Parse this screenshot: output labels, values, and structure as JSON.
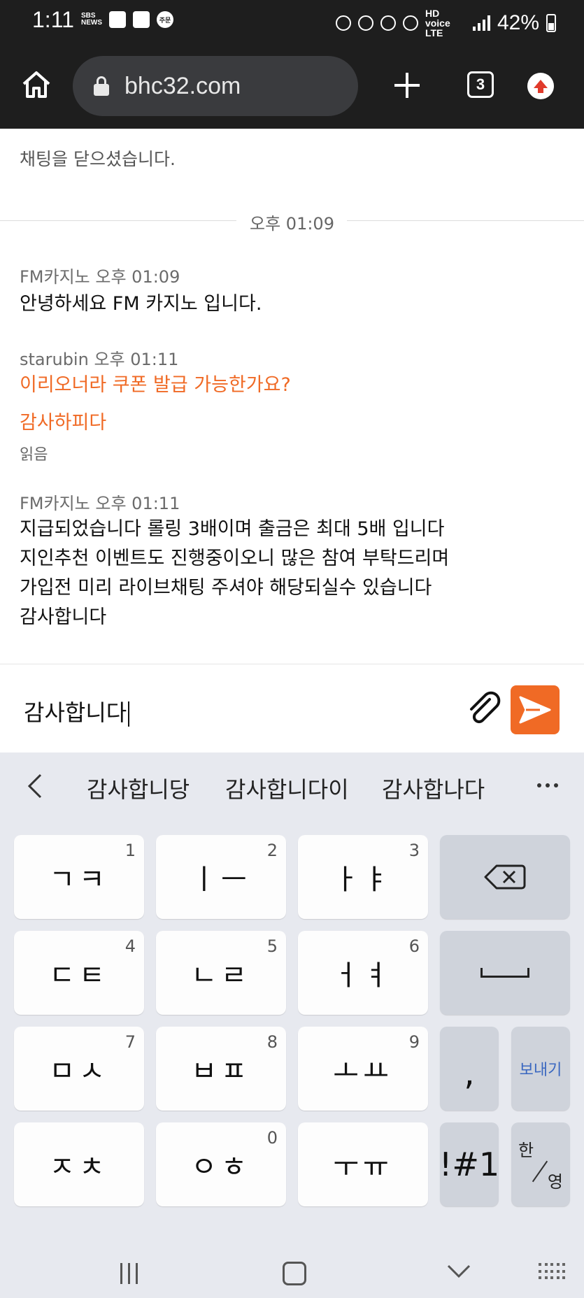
{
  "status_bar": {
    "time": "1:11",
    "left_icons": [
      "SBS NEWS",
      "calendar",
      "gallery",
      "주문"
    ],
    "network": "HD voice LTE",
    "battery": "42%"
  },
  "browser": {
    "url": "bhc32.com",
    "tab_count": "3"
  },
  "chat": {
    "closed_note": "채팅을 닫으셨습니다.",
    "time_divider": "오후 01:09",
    "messages": [
      {
        "meta": "FM카지노 오후 01:09",
        "lines": [
          "안녕하세요 FM 카지노 입니다."
        ]
      },
      {
        "meta": "starubin 오후 01:11",
        "lines": [
          "이리오너라 쿠폰 발급 가능한가요?",
          "감사하피다"
        ],
        "read": "읽음"
      },
      {
        "meta": "FM카지노 오후 01:11",
        "lines": [
          "지급되었습니다 롤링 3배이며 출금은 최대 5배 입니다",
          "지인추천 이벤트도 진행중이오니 많은 참여 부탁드리며",
          "가입전 미리 라이브채팅 주셔야 해당되실수 있습니다",
          "감사합니다"
        ]
      }
    ]
  },
  "input": {
    "value": "감사합니다"
  },
  "keyboard": {
    "suggestions": [
      "감사합니당",
      "감사합니다이",
      "감사합나다"
    ],
    "rows": [
      [
        {
          "main": "ㄱㅋ",
          "hint": "1"
        },
        {
          "main": "ㅣㅡ",
          "hint": "2"
        },
        {
          "main": "ㅏㅑ",
          "hint": "3"
        }
      ],
      [
        {
          "main": "ㄷㅌ",
          "hint": "4"
        },
        {
          "main": "ㄴㄹ",
          "hint": "5"
        },
        {
          "main": "ㅓㅕ",
          "hint": "6"
        }
      ],
      [
        {
          "main": "ㅁㅅ",
          "hint": "7"
        },
        {
          "main": "ㅂㅍ",
          "hint": "8"
        },
        {
          "main": "ㅗㅛ",
          "hint": "9"
        }
      ],
      [
        {
          "main": "ㅈㅊ",
          "hint": ""
        },
        {
          "main": "ㅇㅎ",
          "hint": "0"
        },
        {
          "main": "ㅜㅠ",
          "hint": ""
        }
      ]
    ],
    "comma": ",",
    "send_label": "보내기",
    "symbols_label": "!#1",
    "lang_top": "한",
    "lang_bottom": "영"
  },
  "colors": {
    "accent": "#f06a25",
    "dark_bar": "#1e1e1e",
    "keyboard_bg": "#e7e9ef"
  }
}
